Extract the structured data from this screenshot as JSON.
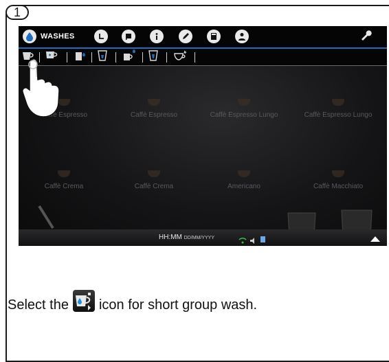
{
  "step": {
    "number": "1"
  },
  "screen": {
    "topbar": {
      "washes_label": "WASHES",
      "icons": [
        "water-drop-icon",
        "clock-icon",
        "flag-icon",
        "info-icon",
        "pencil-icon",
        "calculator-icon",
        "user-icon",
        "wrench-icon"
      ],
      "accent_color": "#1f6fbf"
    },
    "subbar": {
      "icons": [
        "short-group-wash-icon",
        "coffee-cup-wash-icon",
        "milk-wash-icon",
        "glass-wash-icon",
        "milk-jug-wash-icon",
        "glass-wash-2-icon",
        "cappuccinatore-wash-icon"
      ]
    },
    "drinks": [
      {
        "label": "Caffè Espresso"
      },
      {
        "label": "Caffè Espresso"
      },
      {
        "label": "Caffè Espresso Lungo"
      },
      {
        "label": "Caffè Espresso Lungo"
      },
      {
        "label": "Caffè Crema"
      },
      {
        "label": "Caffè Crema"
      },
      {
        "label": "Americano"
      },
      {
        "label": "Caffè Macchiato"
      }
    ],
    "statusbar": {
      "time": "HH:MM",
      "date": "DD/MM/YYYY"
    }
  },
  "instruction": {
    "before": "Select the",
    "after": "icon for short group wash.",
    "icon": "short-group-wash-icon"
  }
}
